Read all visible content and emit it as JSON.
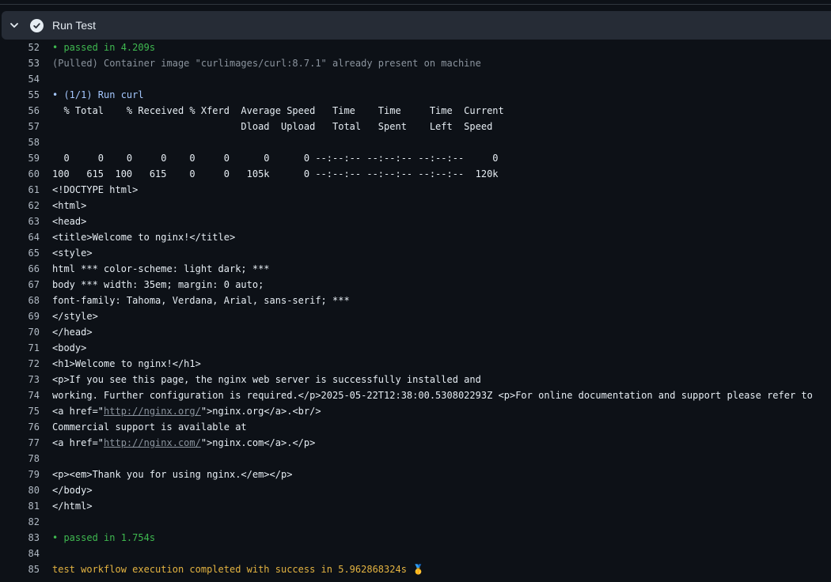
{
  "header": {
    "title": "Run Test"
  },
  "log_lines": [
    {
      "n": "52",
      "segments": [
        {
          "t": "• passed in 4.209s",
          "c": "green"
        }
      ]
    },
    {
      "n": "53",
      "segments": [
        {
          "t": "(Pulled) Container image \"curlimages/curl:8.7.1\" already present on machine",
          "c": "gray"
        }
      ]
    },
    {
      "n": "54",
      "segments": []
    },
    {
      "n": "55",
      "segments": [
        {
          "t": "• (1/1) Run curl",
          "c": "blue"
        }
      ]
    },
    {
      "n": "56",
      "segments": [
        {
          "t": "  % Total    % Received % Xferd  Average Speed   Time    Time     Time  Current",
          "c": ""
        }
      ]
    },
    {
      "n": "57",
      "segments": [
        {
          "t": "                                 Dload  Upload   Total   Spent    Left  Speed",
          "c": ""
        }
      ]
    },
    {
      "n": "58",
      "segments": []
    },
    {
      "n": "59",
      "segments": [
        {
          "t": "  0     0    0     0    0     0      0      0 --:--:-- --:--:-- --:--:--     0",
          "c": ""
        }
      ]
    },
    {
      "n": "60",
      "segments": [
        {
          "t": "100   615  100   615    0     0   105k      0 --:--:-- --:--:-- --:--:--  120k",
          "c": ""
        }
      ]
    },
    {
      "n": "61",
      "segments": [
        {
          "t": "<!DOCTYPE html>",
          "c": ""
        }
      ]
    },
    {
      "n": "62",
      "segments": [
        {
          "t": "<html>",
          "c": ""
        }
      ]
    },
    {
      "n": "63",
      "segments": [
        {
          "t": "<head>",
          "c": ""
        }
      ]
    },
    {
      "n": "64",
      "segments": [
        {
          "t": "<title>Welcome to nginx!</title>",
          "c": ""
        }
      ]
    },
    {
      "n": "65",
      "segments": [
        {
          "t": "<style>",
          "c": ""
        }
      ]
    },
    {
      "n": "66",
      "segments": [
        {
          "t": "html *** color-scheme: light dark; ***",
          "c": ""
        }
      ]
    },
    {
      "n": "67",
      "segments": [
        {
          "t": "body *** width: 35em; margin: 0 auto;",
          "c": ""
        }
      ]
    },
    {
      "n": "68",
      "segments": [
        {
          "t": "font-family: Tahoma, Verdana, Arial, sans-serif; ***",
          "c": ""
        }
      ]
    },
    {
      "n": "69",
      "segments": [
        {
          "t": "</style>",
          "c": ""
        }
      ]
    },
    {
      "n": "70",
      "segments": [
        {
          "t": "</head>",
          "c": ""
        }
      ]
    },
    {
      "n": "71",
      "segments": [
        {
          "t": "<body>",
          "c": ""
        }
      ]
    },
    {
      "n": "72",
      "segments": [
        {
          "t": "<h1>Welcome to nginx!</h1>",
          "c": ""
        }
      ]
    },
    {
      "n": "73",
      "segments": [
        {
          "t": "<p>If you see this page, the nginx web server is successfully installed and",
          "c": ""
        }
      ]
    },
    {
      "n": "74",
      "segments": [
        {
          "t": "working. Further configuration is required.</p>2025-05-22T12:38:00.530802293Z <p>For online documentation and support please refer to",
          "c": ""
        }
      ]
    },
    {
      "n": "75",
      "segments": [
        {
          "t": "<a href=\"",
          "c": ""
        },
        {
          "t": "http://nginx.org/",
          "c": "link"
        },
        {
          "t": "\">nginx.org</a>.<br/>",
          "c": ""
        }
      ]
    },
    {
      "n": "76",
      "segments": [
        {
          "t": "Commercial support is available at",
          "c": ""
        }
      ]
    },
    {
      "n": "77",
      "segments": [
        {
          "t": "<a href=\"",
          "c": ""
        },
        {
          "t": "http://nginx.com/",
          "c": "link"
        },
        {
          "t": "\">nginx.com</a>.</p>",
          "c": ""
        }
      ]
    },
    {
      "n": "78",
      "segments": []
    },
    {
      "n": "79",
      "segments": [
        {
          "t": "<p><em>Thank you for using nginx.</em></p>",
          "c": ""
        }
      ]
    },
    {
      "n": "80",
      "segments": [
        {
          "t": "</body>",
          "c": ""
        }
      ]
    },
    {
      "n": "81",
      "segments": [
        {
          "t": "</html>",
          "c": ""
        }
      ]
    },
    {
      "n": "82",
      "segments": []
    },
    {
      "n": "83",
      "segments": [
        {
          "t": "• passed in 1.754s",
          "c": "green"
        }
      ]
    },
    {
      "n": "84",
      "segments": []
    },
    {
      "n": "85",
      "segments": [
        {
          "t": "test workflow execution completed with success in 5.962868324s 🥇",
          "c": "yellow"
        }
      ]
    }
  ],
  "colors": {
    "background": "#0d1117",
    "header_bg": "#262c36",
    "passed": "#3fb950",
    "pulled": "#8b949e",
    "step": "#a5c8ff",
    "success": "#e3b341"
  },
  "icons": {
    "collapse": "chevron-down-icon",
    "status": "check-circle-icon"
  }
}
